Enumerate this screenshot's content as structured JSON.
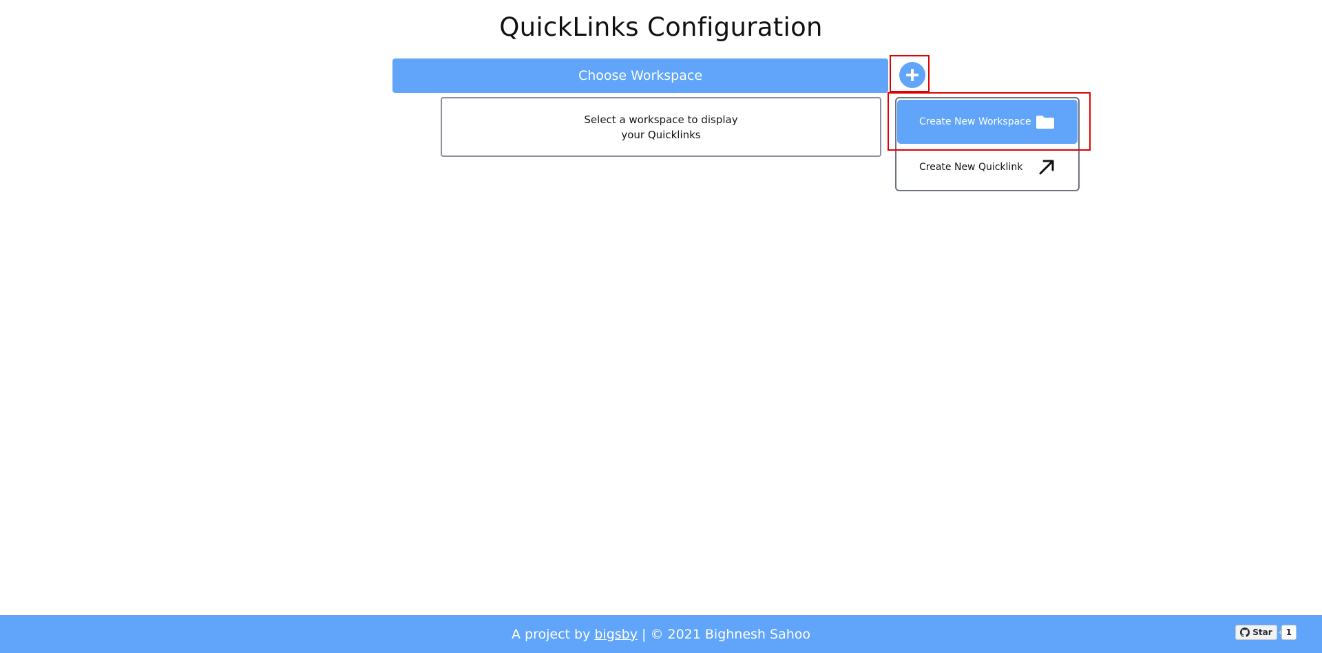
{
  "page": {
    "title": "QuickLinks Configuration"
  },
  "workspace": {
    "choose_label": "Choose Workspace",
    "empty_message": "Select a workspace to display your Quicklinks"
  },
  "add_menu": {
    "button_icon": "plus-icon",
    "items": [
      {
        "label": "Create New Workspace",
        "icon": "folder-icon"
      },
      {
        "label": "Create New Quicklink",
        "icon": "arrow-up-right-icon"
      }
    ]
  },
  "footer": {
    "prefix": "A project by ",
    "author_link": "bigsby",
    "suffix": " | © 2021 Bighnesh Sahoo"
  },
  "github_widget": {
    "star_label": "Star",
    "star_count": "1"
  },
  "colors": {
    "accent": "#60a5fa",
    "highlight": "#e00000"
  }
}
